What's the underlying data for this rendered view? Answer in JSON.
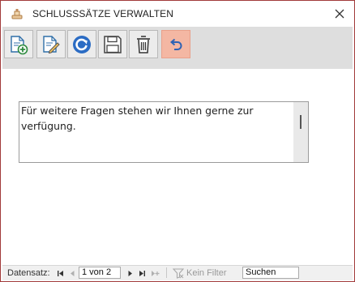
{
  "window": {
    "title": "SCHLUSSSÄTZE VERWALTEN",
    "accent_color": "#a23a3a"
  },
  "toolbar": {
    "buttons": [
      {
        "name": "new-record",
        "icon": "document-add-icon"
      },
      {
        "name": "edit-record",
        "icon": "document-edit-icon"
      },
      {
        "name": "refresh",
        "icon": "refresh-icon"
      },
      {
        "name": "save",
        "icon": "save-icon"
      },
      {
        "name": "delete",
        "icon": "trash-icon"
      },
      {
        "name": "undo",
        "icon": "undo-icon",
        "highlight_color": "#f4b7a3"
      }
    ]
  },
  "textbox": {
    "value": "Für weitere Fragen stehen wir Ihnen gerne zur verfügung."
  },
  "navigation": {
    "label": "Datensatz:",
    "record_position": "1 von 2",
    "filter_label": "Kein Filter",
    "search_placeholder": "Suchen"
  }
}
